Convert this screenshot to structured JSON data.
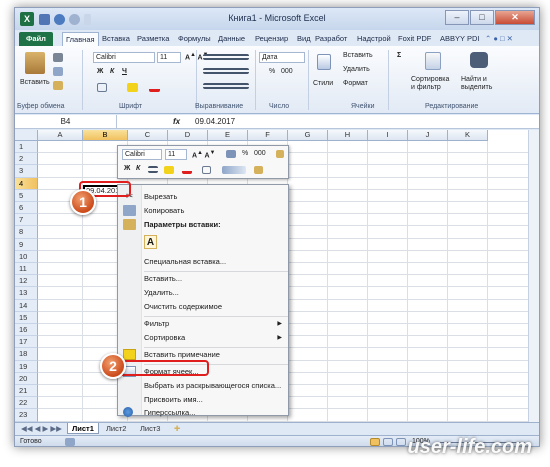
{
  "window": {
    "title": "Книга1 - Microsoft Excel",
    "app_icon": "excel-icon",
    "minimize": "–",
    "maximize": "□",
    "close": "✕"
  },
  "tabs": [
    "Файл",
    "Главная",
    "Вставка",
    "Разметка",
    "Формулы",
    "Данные",
    "Рецензир",
    "Вид",
    "Разработ",
    "Надстрой",
    "Foxit PDF",
    "ABBYY PDI"
  ],
  "ribbon": {
    "paste": "Вставить",
    "font_name": "Calibri",
    "font_size": "11",
    "bold": "Ж",
    "italic": "К",
    "underline": "Ч",
    "number_format": "Дата",
    "percent": "%",
    "thousands": "000",
    "styles": "Стили",
    "insert": "Вставить",
    "delete": "Удалить",
    "format": "Формат",
    "sort_filter": "Сортировка и фильтр",
    "find_select": "Найти и выделить",
    "groups": {
      "clipboard": "Буфер обмена",
      "font": "Шрифт",
      "alignment": "Выравнивание",
      "number": "Число",
      "cells": "Ячейки",
      "editing": "Редактирование"
    }
  },
  "formula_bar": {
    "name_box": "B4",
    "fx": "fx",
    "value": "09.04.2017"
  },
  "columns": [
    "A",
    "B",
    "C",
    "D",
    "E",
    "F",
    "G",
    "H",
    "I",
    "J",
    "K"
  ],
  "rows": [
    "1",
    "2",
    "3",
    "4",
    "5",
    "6",
    "7",
    "8",
    "9",
    "10",
    "11",
    "12",
    "13",
    "14",
    "15",
    "16",
    "17",
    "18",
    "19",
    "20",
    "21",
    "22",
    "23"
  ],
  "active_cell": {
    "ref": "B4",
    "value": "09.04.2017"
  },
  "mini_toolbar": {
    "font": "Calibri",
    "size": "11",
    "percent": "%",
    "thousands": "000",
    "bold": "Ж",
    "italic": "К"
  },
  "context_menu": {
    "cut": "Вырезать",
    "copy": "Копировать",
    "paste_options": "Параметры вставки:",
    "paste_icon": "A",
    "paste_special": "Специальная вставка...",
    "insert": "Вставить...",
    "delete": "Удалить...",
    "clear": "Очистить содержимое",
    "filter": "Фильтр",
    "sort": "Сортировка",
    "insert_comment": "Вставить примечание",
    "format_cells": "Формат ячеек...",
    "pick_list": "Выбрать из раскрывающегося списка...",
    "define_name": "Присвоить имя...",
    "hyperlink": "Гиперссылка..."
  },
  "badges": [
    "1",
    "2"
  ],
  "sheets": [
    "Лист1",
    "Лист2",
    "Лист3"
  ],
  "status": {
    "ready": "Готово",
    "zoom": "100%"
  },
  "watermark": "user-life.com",
  "colors": {
    "excel_green": "#1f7246",
    "highlight_red": "#e01e1e",
    "badge_orange": "#cb4a1a",
    "selected_header": "#f1c15f"
  }
}
